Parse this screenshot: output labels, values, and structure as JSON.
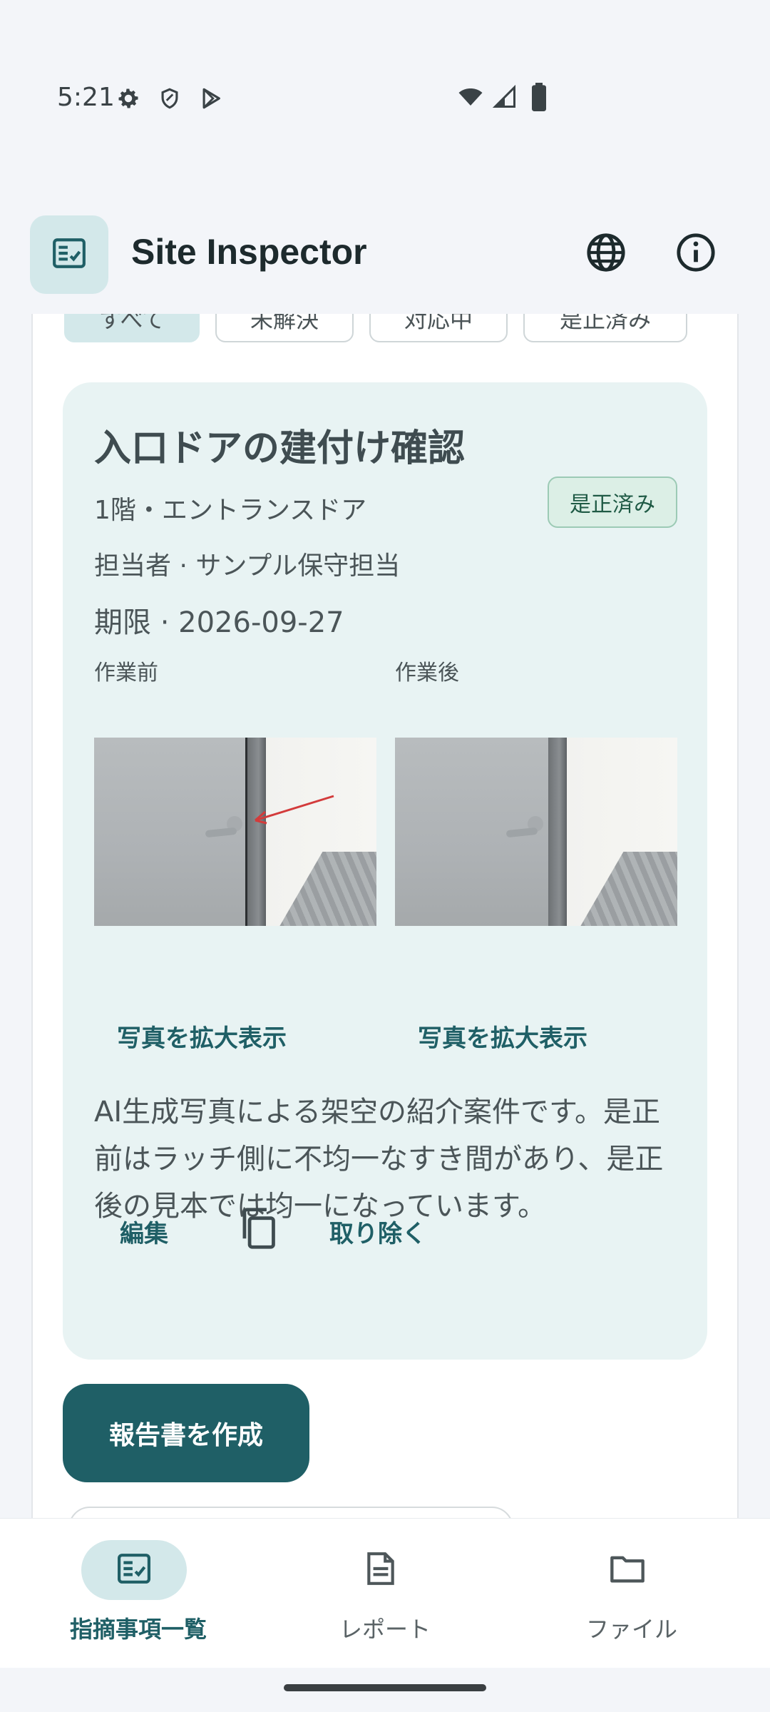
{
  "status_bar": {
    "time": "5:21",
    "icons_left": [
      "gear-icon",
      "shield-icon",
      "play-store-icon"
    ],
    "icons_right": [
      "wifi-icon",
      "signal-icon",
      "battery-icon"
    ]
  },
  "app_bar": {
    "title": "Site Inspector",
    "actions": [
      "globe-icon",
      "info-icon"
    ]
  },
  "filter_chips": [
    {
      "label": "すべて",
      "selected": true
    },
    {
      "label": "未解決",
      "selected": false
    },
    {
      "label": "対応中",
      "selected": false
    },
    {
      "label": "是正済み",
      "selected": false
    }
  ],
  "card": {
    "title": "入口ドアの建付け確認",
    "location": "1階・エントランスドア",
    "status": "是正済み",
    "assignee": "担当者 · サンプル保守担当",
    "due": "期限 · 2026-09-27",
    "before_label": "作業前",
    "after_label": "作業後",
    "enlarge_label": "写真を拡大表示",
    "description": "AI生成写真による架空の紹介案件です。是正前はラッチ側に不均一なすき間があり、是正後の見本では均一になっています。",
    "edit_label": "編集",
    "remove_label": "取り除く"
  },
  "report_button": "報告書を作成",
  "bottom_nav": [
    {
      "label": "指摘事項一覧",
      "icon": "checklist-icon",
      "active": true
    },
    {
      "label": "レポート",
      "icon": "document-icon",
      "active": false
    },
    {
      "label": "ファイル",
      "icon": "folder-icon",
      "active": false
    }
  ],
  "colors": {
    "primary": "#1f5f66",
    "card_bg": "#e8f3f3",
    "chip_selected": "#d3e8ea",
    "badge_bg": "#dcefe6"
  }
}
